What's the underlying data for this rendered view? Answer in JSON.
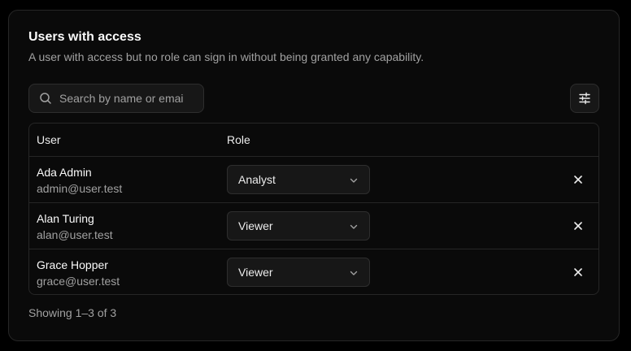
{
  "header": {
    "title": "Users with access",
    "subtitle": "A user with access but no role can sign in without being granted any capability."
  },
  "search": {
    "placeholder": "Search by name or emai",
    "value": "",
    "icon": "search-icon"
  },
  "filter_button": {
    "icon": "sliders-icon"
  },
  "table": {
    "columns": [
      "User",
      "Role"
    ],
    "rows": [
      {
        "name": "Ada Admin",
        "email": "admin@user.test",
        "role": "Analyst"
      },
      {
        "name": "Alan Turing",
        "email": "alan@user.test",
        "role": "Viewer"
      },
      {
        "name": "Grace Hopper",
        "email": "grace@user.test",
        "role": "Viewer"
      }
    ]
  },
  "footer": {
    "pagination": "Showing 1–3 of 3"
  },
  "colors": {
    "background": "#000000",
    "card": "#0a0a0a",
    "border": "#262626",
    "input": "#171717",
    "text": "#ededed",
    "muted": "#a1a1a1"
  }
}
